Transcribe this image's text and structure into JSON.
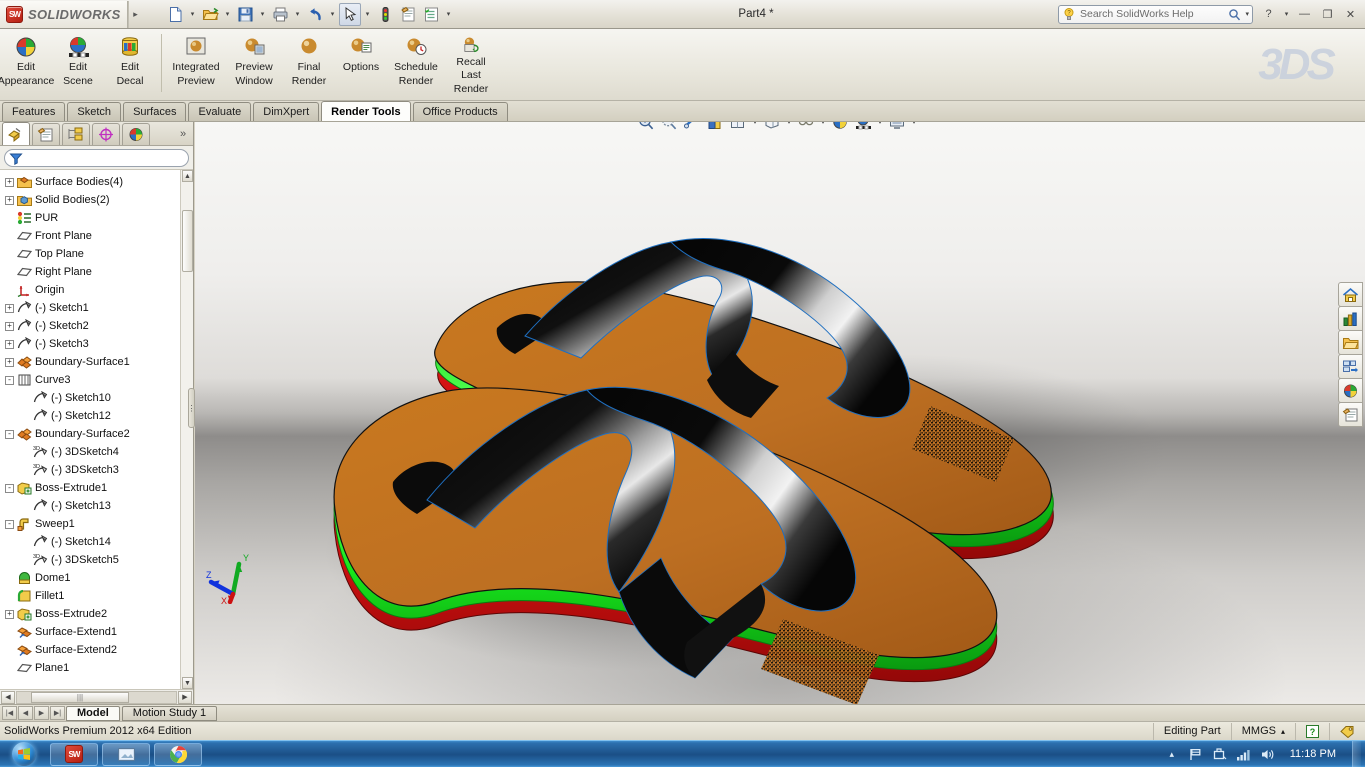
{
  "titlebar": {
    "brand": "SOLIDWORKS",
    "brand_mark": "SW",
    "document_title": "Part4 *",
    "quick_access": [
      {
        "name": "new-document-icon",
        "label": "New"
      },
      {
        "name": "open-document-icon",
        "label": "Open"
      },
      {
        "name": "save-icon",
        "label": "Save"
      },
      {
        "name": "print-icon",
        "label": "Print"
      },
      {
        "name": "undo-icon",
        "label": "Undo"
      },
      {
        "name": "select-cursor-icon",
        "label": "Select"
      },
      {
        "name": "rebuild-icon",
        "label": "Rebuild"
      },
      {
        "name": "file-properties-icon",
        "label": "File Properties"
      },
      {
        "name": "options-icon",
        "label": "Options"
      }
    ],
    "search_placeholder": "Search SolidWorks Help",
    "help_label": "?",
    "minimize_label": "—",
    "restore_label": "❐",
    "close_label": "✕"
  },
  "ribbon": {
    "groups": [
      {
        "name": "appearance-group",
        "buttons": [
          {
            "icon": "edit-appearance-icon",
            "line1": "Edit",
            "line2": "Appearance"
          },
          {
            "icon": "edit-scene-icon",
            "line1": "Edit",
            "line2": "Scene"
          },
          {
            "icon": "edit-decal-icon",
            "line1": "Edit",
            "line2": "Decal"
          }
        ]
      },
      {
        "name": "render-group",
        "buttons": [
          {
            "icon": "integrated-preview-icon",
            "line1": "Integrated",
            "line2": "Preview"
          },
          {
            "icon": "preview-window-icon",
            "line1": "Preview",
            "line2": "Window"
          },
          {
            "icon": "final-render-icon",
            "line1": "Final",
            "line2": "Render"
          },
          {
            "icon": "render-options-icon",
            "line1": "Options",
            "line2": ""
          },
          {
            "icon": "schedule-render-icon",
            "line1": "Schedule",
            "line2": "Render"
          },
          {
            "icon": "recall-last-render-icon",
            "line1": "Recall",
            "line2": "Last",
            "line3": "Render"
          }
        ]
      }
    ],
    "watermark": "3DS"
  },
  "command_tabs": [
    {
      "label": "Features",
      "selected": false
    },
    {
      "label": "Sketch",
      "selected": false
    },
    {
      "label": "Surfaces",
      "selected": false
    },
    {
      "label": "Evaluate",
      "selected": false
    },
    {
      "label": "DimXpert",
      "selected": false
    },
    {
      "label": "Render Tools",
      "selected": true
    },
    {
      "label": "Office Products",
      "selected": false
    }
  ],
  "feature_manager": {
    "tabs": [
      {
        "name": "feature-tree-tab",
        "selected": true
      },
      {
        "name": "property-manager-tab",
        "selected": false
      },
      {
        "name": "configuration-manager-tab",
        "selected": false
      },
      {
        "name": "dimxpert-manager-tab",
        "selected": false
      },
      {
        "name": "display-manager-tab",
        "selected": false
      }
    ],
    "more_label": "»",
    "filter_placeholder": "",
    "tree": [
      {
        "label": "Surface Bodies(4)",
        "indent": 0,
        "expander": "+",
        "icon": "surface-bodies-folder-icon"
      },
      {
        "label": "Solid Bodies(2)",
        "indent": 0,
        "expander": "+",
        "icon": "solid-bodies-folder-icon"
      },
      {
        "label": "PUR",
        "indent": 0,
        "expander": "",
        "icon": "material-icon"
      },
      {
        "label": "Front Plane",
        "indent": 0,
        "expander": "",
        "icon": "plane-icon"
      },
      {
        "label": "Top Plane",
        "indent": 0,
        "expander": "",
        "icon": "plane-icon"
      },
      {
        "label": "Right Plane",
        "indent": 0,
        "expander": "",
        "icon": "plane-icon"
      },
      {
        "label": "Origin",
        "indent": 0,
        "expander": "",
        "icon": "origin-icon"
      },
      {
        "label": "(-) Sketch1",
        "indent": 0,
        "expander": "+",
        "icon": "sketch-icon"
      },
      {
        "label": "(-) Sketch2",
        "indent": 0,
        "expander": "+",
        "icon": "sketch-icon"
      },
      {
        "label": "(-) Sketch3",
        "indent": 0,
        "expander": "+",
        "icon": "sketch-icon"
      },
      {
        "label": "Boundary-Surface1",
        "indent": 0,
        "expander": "+",
        "icon": "boundary-surface-icon"
      },
      {
        "label": "Curve3",
        "indent": 0,
        "expander": "-",
        "icon": "curve-icon"
      },
      {
        "label": "(-) Sketch10",
        "indent": 1,
        "expander": "",
        "icon": "sketch-icon"
      },
      {
        "label": "(-) Sketch12",
        "indent": 1,
        "expander": "",
        "icon": "sketch-icon"
      },
      {
        "label": "Boundary-Surface2",
        "indent": 0,
        "expander": "-",
        "icon": "boundary-surface-icon"
      },
      {
        "label": "(-) 3DSketch4",
        "indent": 1,
        "expander": "",
        "icon": "sketch3d-icon"
      },
      {
        "label": "(-) 3DSketch3",
        "indent": 1,
        "expander": "",
        "icon": "sketch3d-icon"
      },
      {
        "label": "Boss-Extrude1",
        "indent": 0,
        "expander": "-",
        "icon": "boss-extrude-icon"
      },
      {
        "label": "(-) Sketch13",
        "indent": 1,
        "expander": "",
        "icon": "sketch-icon"
      },
      {
        "label": "Sweep1",
        "indent": 0,
        "expander": "-",
        "icon": "sweep-icon"
      },
      {
        "label": "(-) Sketch14",
        "indent": 1,
        "expander": "",
        "icon": "sketch-icon"
      },
      {
        "label": "(-) 3DSketch5",
        "indent": 1,
        "expander": "",
        "icon": "sketch3d-icon"
      },
      {
        "label": "Dome1",
        "indent": 0,
        "expander": "",
        "icon": "dome-icon"
      },
      {
        "label": "Fillet1",
        "indent": 0,
        "expander": "",
        "icon": "fillet-icon"
      },
      {
        "label": "Boss-Extrude2",
        "indent": 0,
        "expander": "+",
        "icon": "boss-extrude-icon"
      },
      {
        "label": "Surface-Extend1",
        "indent": 0,
        "expander": "",
        "icon": "surface-extend-icon"
      },
      {
        "label": "Surface-Extend2",
        "indent": 0,
        "expander": "",
        "icon": "surface-extend-icon"
      },
      {
        "label": "Plane1",
        "indent": 0,
        "expander": "",
        "icon": "plane-icon"
      }
    ]
  },
  "view_toolbar": [
    {
      "name": "zoom-to-fit-icon",
      "dropdown": false
    },
    {
      "name": "zoom-to-area-icon",
      "dropdown": false
    },
    {
      "name": "previous-view-icon",
      "dropdown": false
    },
    {
      "name": "section-view-icon",
      "dropdown": false
    },
    {
      "name": "view-orientation-icon",
      "dropdown": true
    },
    {
      "name": "display-style-icon",
      "dropdown": true
    },
    {
      "name": "hide-show-items-icon",
      "dropdown": true
    },
    {
      "name": "edit-appearance-icon",
      "dropdown": false
    },
    {
      "name": "apply-scene-icon",
      "dropdown": true
    },
    {
      "name": "view-settings-icon",
      "dropdown": true
    }
  ],
  "graphics_window_buttons": [
    {
      "name": "split-horizontal-icon"
    },
    {
      "name": "split-vertical-icon"
    },
    {
      "name": "minimize-document-icon",
      "label": "—"
    },
    {
      "name": "restore-document-icon",
      "label": "❐"
    },
    {
      "name": "close-document-icon",
      "label": "✕"
    }
  ],
  "task_pane": [
    {
      "name": "solidworks-resources-icon"
    },
    {
      "name": "design-library-icon"
    },
    {
      "name": "file-explorer-icon"
    },
    {
      "name": "view-palette-icon"
    },
    {
      "name": "appearances-scenes-decals-icon"
    },
    {
      "name": "custom-properties-icon"
    }
  ],
  "triad": {
    "x_label": "X",
    "y_label": "Y",
    "z_label": "Z",
    "x_color": "#cc1111",
    "y_color": "#11aa22",
    "z_color": "#1133dd"
  },
  "model": {
    "description": "Pair of flip-flop sandals",
    "colors": {
      "footbed": "#bd6f22",
      "midsole_green": "#18e81c",
      "outsole_red": "#cc1010",
      "strap": "#0a0a0a",
      "edge_highlight": "#2b7fd4"
    },
    "decal_label": "decal-texture-patch"
  },
  "bottom_tabs": {
    "nav": [
      {
        "name": "first-tab-button",
        "label": "|◀"
      },
      {
        "name": "previous-tab-button",
        "label": "◀"
      },
      {
        "name": "next-tab-button",
        "label": "▶"
      },
      {
        "name": "last-tab-button",
        "label": "▶|"
      }
    ],
    "tabs": [
      {
        "label": "Model",
        "selected": true
      },
      {
        "label": "Motion Study 1",
        "selected": false
      }
    ]
  },
  "statusbar": {
    "edition": "SolidWorks Premium 2012 x64 Edition",
    "editing_state": "Editing Part",
    "units": "MMGS",
    "units_arrow": "▴",
    "help_badge": "?",
    "tag_icon": "tag-icon"
  },
  "taskbar": {
    "start_label": "Start",
    "tasks": [
      {
        "name": "taskbar-solidworks",
        "label": "SW"
      },
      {
        "name": "taskbar-photo-viewer",
        "label": ""
      },
      {
        "name": "taskbar-chrome",
        "label": ""
      }
    ],
    "tray": [
      {
        "name": "show-hidden-icons-arrow",
        "label": "▴"
      },
      {
        "name": "action-center-flag-icon",
        "label": ""
      },
      {
        "name": "safely-remove-hardware-icon",
        "label": ""
      },
      {
        "name": "network-signal-icon",
        "label": ""
      },
      {
        "name": "volume-icon",
        "label": ""
      }
    ],
    "clock": "11:18 PM"
  }
}
